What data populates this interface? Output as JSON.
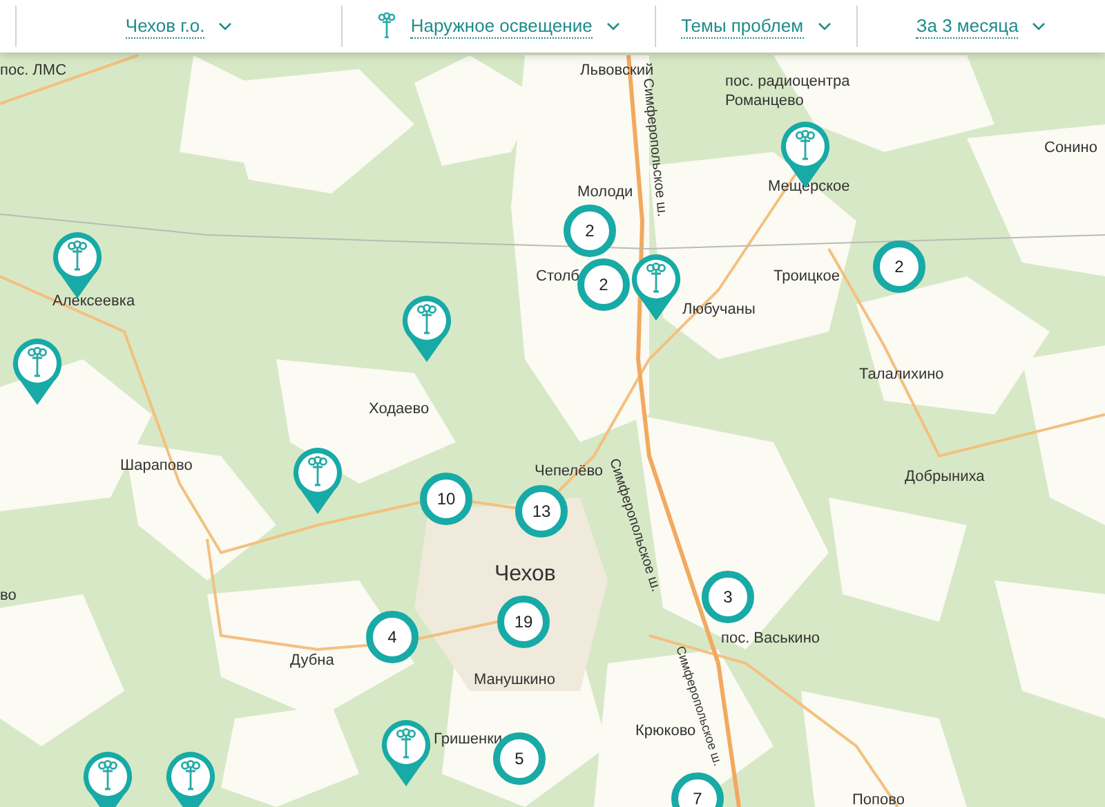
{
  "filters": [
    {
      "label": "Чехов г.о.",
      "has_icon": false
    },
    {
      "label": "Наружное освещение",
      "has_icon": true
    },
    {
      "label": "Темы проблем",
      "has_icon": false
    },
    {
      "label": "За 3 месяца",
      "has_icon": false
    }
  ],
  "map": {
    "place_labels": [
      {
        "text": "пос. ЛМС",
        "kind": "village"
      },
      {
        "text": "Львовский",
        "kind": "village"
      },
      {
        "text": "пос. радиоцентра Романцево",
        "kind": "village"
      },
      {
        "text": "Сонино",
        "kind": "village"
      },
      {
        "text": "Молоди",
        "kind": "village"
      },
      {
        "text": "Мещерское",
        "kind": "village"
      },
      {
        "text": "Столб",
        "kind": "village"
      },
      {
        "text": "Любучаны",
        "kind": "village"
      },
      {
        "text": "Алексеевка",
        "kind": "village"
      },
      {
        "text": "Троицкое",
        "kind": "village"
      },
      {
        "text": "Талалихино",
        "kind": "village"
      },
      {
        "text": "Ходаево",
        "kind": "village"
      },
      {
        "text": "Шарапово",
        "kind": "village"
      },
      {
        "text": "Чепелёво",
        "kind": "village"
      },
      {
        "text": "Добрыниха",
        "kind": "village"
      },
      {
        "text": "Чехов",
        "kind": "city"
      },
      {
        "text": "во",
        "kind": "village"
      },
      {
        "text": "пос. Васькино",
        "kind": "village"
      },
      {
        "text": "Дубна",
        "kind": "village"
      },
      {
        "text": "Манушкино",
        "kind": "village"
      },
      {
        "text": "Гришенки",
        "kind": "village"
      },
      {
        "text": "Крюково",
        "kind": "village"
      },
      {
        "text": "Попово",
        "kind": "village"
      },
      {
        "text": "Симферопольское ш.",
        "kind": "road"
      },
      {
        "text": "Симферопольское ш.",
        "kind": "road"
      },
      {
        "text": "Симферопольское ш.",
        "kind": "road"
      }
    ],
    "markers": [
      {
        "kind": "lamp"
      },
      {
        "kind": "lamp"
      },
      {
        "kind": "lamp"
      },
      {
        "kind": "lamp"
      },
      {
        "kind": "lamp"
      },
      {
        "kind": "lamp"
      },
      {
        "kind": "lamp"
      },
      {
        "kind": "lamp"
      },
      {
        "kind": "lamp"
      },
      {
        "kind": "cluster",
        "count": "2"
      },
      {
        "kind": "cluster",
        "count": "2"
      },
      {
        "kind": "cluster",
        "count": "2"
      },
      {
        "kind": "cluster",
        "count": "10"
      },
      {
        "kind": "cluster",
        "count": "13"
      },
      {
        "kind": "cluster",
        "count": "19"
      },
      {
        "kind": "cluster",
        "count": "4"
      },
      {
        "kind": "cluster",
        "count": "3"
      },
      {
        "kind": "cluster",
        "count": "5"
      },
      {
        "kind": "cluster",
        "count": "7"
      }
    ]
  }
}
